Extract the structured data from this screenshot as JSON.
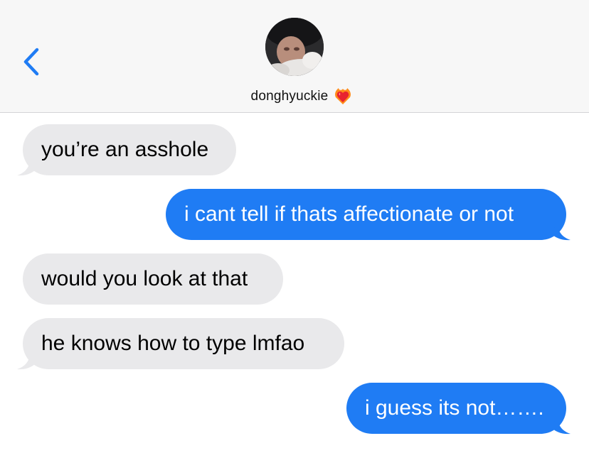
{
  "header": {
    "contact_name": "donghyuckie",
    "contact_emoji": "heart-on-fire-icon"
  },
  "colors": {
    "sent_bubble": "#1f7cf4",
    "received_bubble": "#e9e9eb",
    "accent": "#1f7cf4"
  },
  "messages": [
    {
      "direction": "received",
      "text": "you’re an asshole"
    },
    {
      "direction": "sent",
      "text": "i cant tell if thats affectionate or not"
    },
    {
      "direction": "received",
      "text": "would you look at that"
    },
    {
      "direction": "received",
      "text": "he knows how to type lmfao"
    },
    {
      "direction": "sent",
      "text": "i guess its not……."
    }
  ]
}
